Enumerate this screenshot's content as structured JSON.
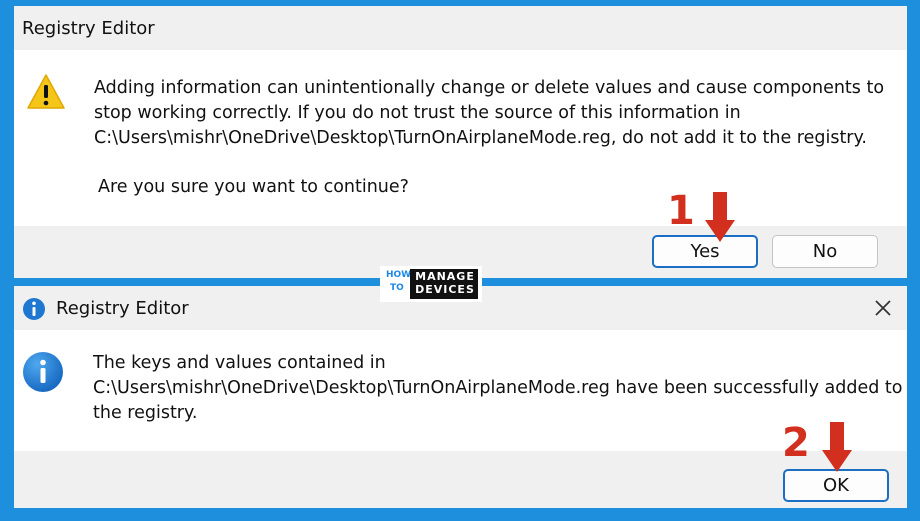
{
  "dialog1": {
    "title": "Registry Editor",
    "message_lines": [
      "Adding information can unintentionally change or delete values and cause components to",
      "stop working correctly. If you do not trust the source of this information in",
      "C:\\Users\\mishr\\OneDrive\\Desktop\\TurnOnAirplaneMode.reg, do not add it to the registry."
    ],
    "question": "Are you sure you want to continue?",
    "yes_label": "Yes",
    "no_label": "No",
    "icon": "warning-icon"
  },
  "dialog2": {
    "title": "Registry Editor",
    "message_lines": [
      "The keys and values contained in",
      "C:\\Users\\mishr\\OneDrive\\Desktop\\TurnOnAirplaneMode.reg have been successfully added to",
      "the registry."
    ],
    "ok_label": "OK",
    "icon": "info-icon"
  },
  "annotations": {
    "step1": "1",
    "step2": "2",
    "color": "#d32f1f"
  },
  "logo": {
    "how": "HOW",
    "to": "TO",
    "manage": "MANAGE",
    "devices": "DEVICES"
  },
  "colors": {
    "background": "#1e8fdc",
    "accent": "#1b6ec2",
    "warning": "#f5c518",
    "info": "#1e78d2"
  }
}
